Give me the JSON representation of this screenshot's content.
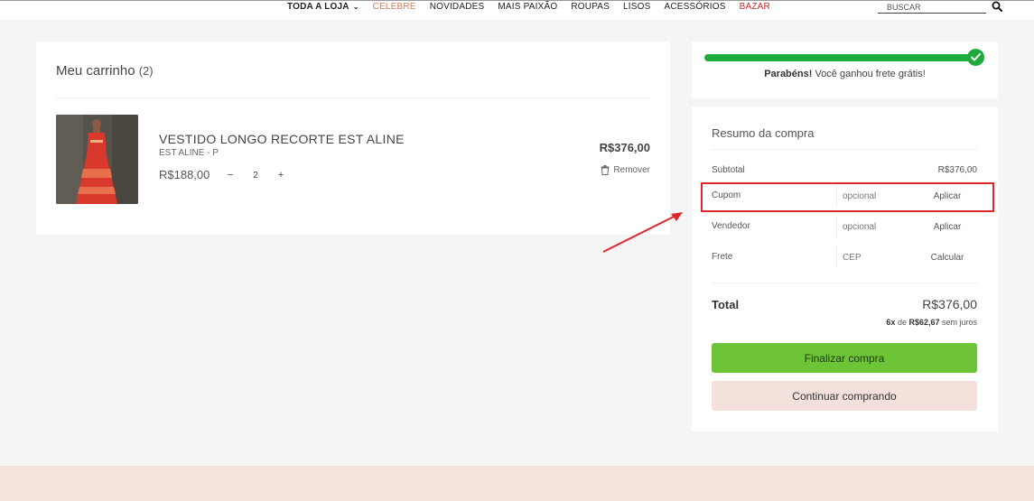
{
  "nav": {
    "items": [
      {
        "label": "TODA A LOJA",
        "style": "bold"
      },
      {
        "label": "CELEBRE",
        "style": "accent"
      },
      {
        "label": "NOVIDADES",
        "style": "normal"
      },
      {
        "label": "MAIS PAIXÃO",
        "style": "normal"
      },
      {
        "label": "ROUPAS",
        "style": "normal"
      },
      {
        "label": "LISOS",
        "style": "normal"
      },
      {
        "label": "ACESSÓRIOS",
        "style": "normal"
      },
      {
        "label": "BAZAR",
        "style": "red"
      }
    ],
    "chevron": "⌄",
    "search_placeholder": "BUSCAR"
  },
  "cart": {
    "title": "Meu carrinho",
    "count": "(2)",
    "item": {
      "name": "VESTIDO LONGO RECORTE EST ALINE",
      "variant": "EST ALINE - P",
      "unit_price": "R$188,00",
      "quantity": "2",
      "minus": "−",
      "plus": "+",
      "line_total": "R$376,00",
      "remove_label": "Remover"
    }
  },
  "shipping": {
    "progress": 1.0,
    "msg_bold": "Parabéns!",
    "msg_rest": " Você ganhou frete grátis!"
  },
  "summary": {
    "title": "Resumo da compra",
    "subtotal_label": "Subtotal",
    "subtotal_value": "R$376,00",
    "coupon_label": "Cupom",
    "coupon_placeholder": "opcional",
    "coupon_action": "Aplicar",
    "seller_label": "Vendedor",
    "seller_placeholder": "opcional",
    "seller_action": "Aplicar",
    "shipping_label": "Frete",
    "shipping_placeholder": "CEP",
    "shipping_action": "Calcular",
    "total_label": "Total",
    "total_value": "R$376,00",
    "inst_count": "6x",
    "inst_de": " de ",
    "inst_value": "R$62,67",
    "inst_rest": " sem juros",
    "checkout_label": "Finalizar compra",
    "continue_label": "Continuar comprando"
  },
  "colors": {
    "accent": "#d47a56",
    "sale": "#c8262d",
    "success": "#1faa3f",
    "checkout": "#6cc436",
    "continue": "#f4e1db",
    "annotation": "#e0262b"
  }
}
